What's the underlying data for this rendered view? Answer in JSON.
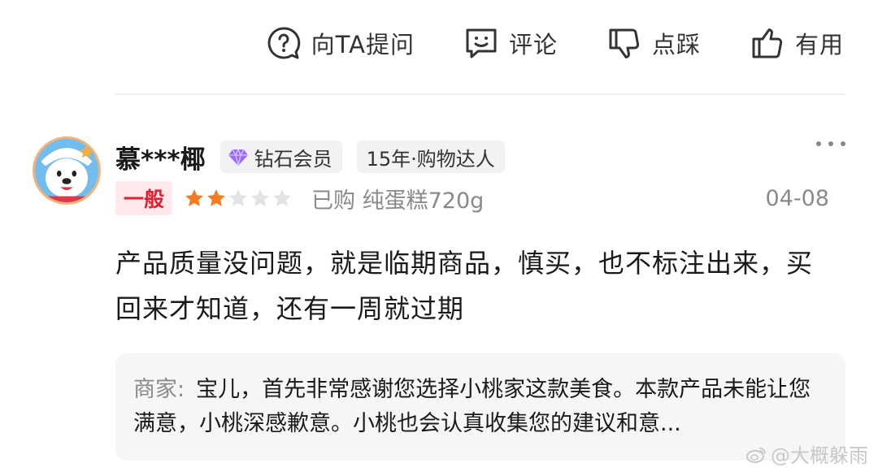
{
  "actions": {
    "ask": "向TA提问",
    "comment": "评论",
    "dislike": "点踩",
    "useful": "有用"
  },
  "review": {
    "username": "慕***椰",
    "member_badge": "钻石会员",
    "years_badge": "15年·购物达人",
    "grade": "一般",
    "rating": 2,
    "rating_max": 5,
    "purchase": "已购 纯蛋糕720g",
    "date": "04-08",
    "text": "产品质量没问题，就是临期商品，慎买，也不标注出来，买回来才知道，还有一周就过期"
  },
  "reply": {
    "label": "商家:",
    "text": "宝儿，首先非常感谢您选择小桃家这款美食。本款产品未能让您满意，小桃深感歉意。小桃也会认真收集您的建议和意..."
  },
  "watermark": "@大概躲雨",
  "colors": {
    "star_filled": "#f47b1f",
    "star_empty": "#e3e3e3",
    "grade_text": "#e4202f",
    "grade_bg": "#fde8ec",
    "diamond": "#9a6cf5"
  }
}
